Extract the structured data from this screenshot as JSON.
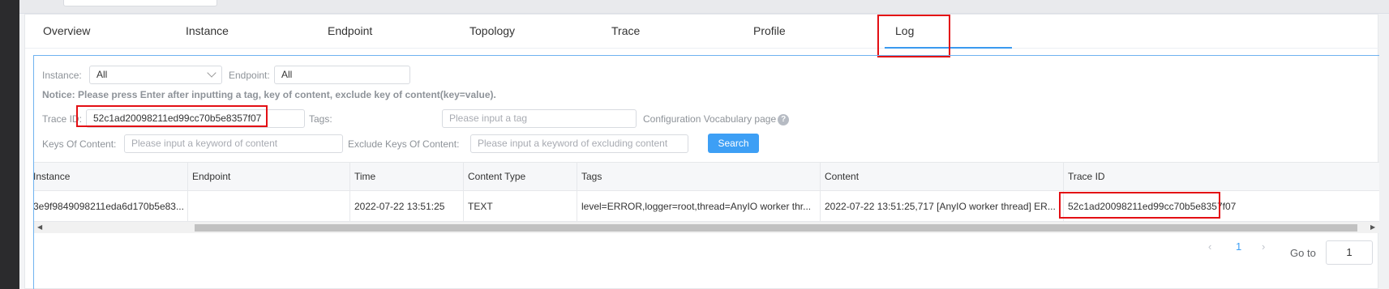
{
  "tabs": [
    "Overview",
    "Instance",
    "Endpoint",
    "Topology",
    "Trace",
    "Profile",
    "Log"
  ],
  "active_tab": "Log",
  "filters": {
    "instance_label": "Instance:",
    "instance_value": "All",
    "endpoint_label": "Endpoint:",
    "endpoint_value": "All",
    "notice": "Notice: Please press Enter after inputting a tag, key of content, exclude key of content(key=value).",
    "trace_id_label": "Trace ID:",
    "trace_id_value": "52c1ad20098211ed99cc70b5e8357f07",
    "tags_label": "Tags:",
    "tags_placeholder": "Please input a tag",
    "vocab_link": "Configuration Vocabulary page",
    "help_icon": "?",
    "keys_label": "Keys Of Content:",
    "keys_placeholder": "Please input a keyword of content",
    "exclude_label": "Exclude Keys Of Content:",
    "exclude_placeholder": "Please input a keyword of excluding content",
    "search_button": "Search"
  },
  "table": {
    "headers": [
      "Instance",
      "Endpoint",
      "Time",
      "Content Type",
      "Tags",
      "Content",
      "Trace ID"
    ],
    "rows": [
      {
        "instance": "3e9f9849098211eda6d170b5e83...",
        "endpoint": "",
        "time": "2022-07-22 13:51:25",
        "content_type": "TEXT",
        "tags": "level=ERROR,logger=root,thread=AnyIO worker thr...",
        "content": "2022-07-22 13:51:25,717 [AnyIO worker thread] ER...",
        "trace_id": "52c1ad20098211ed99cc70b5e8357f07"
      }
    ]
  },
  "pagination": {
    "prev": "‹",
    "page": "1",
    "next": "›",
    "goto_label": "Go to",
    "goto_value": "1"
  },
  "colors": {
    "accent": "#3d9ff5",
    "highlight": "#e30f14"
  }
}
